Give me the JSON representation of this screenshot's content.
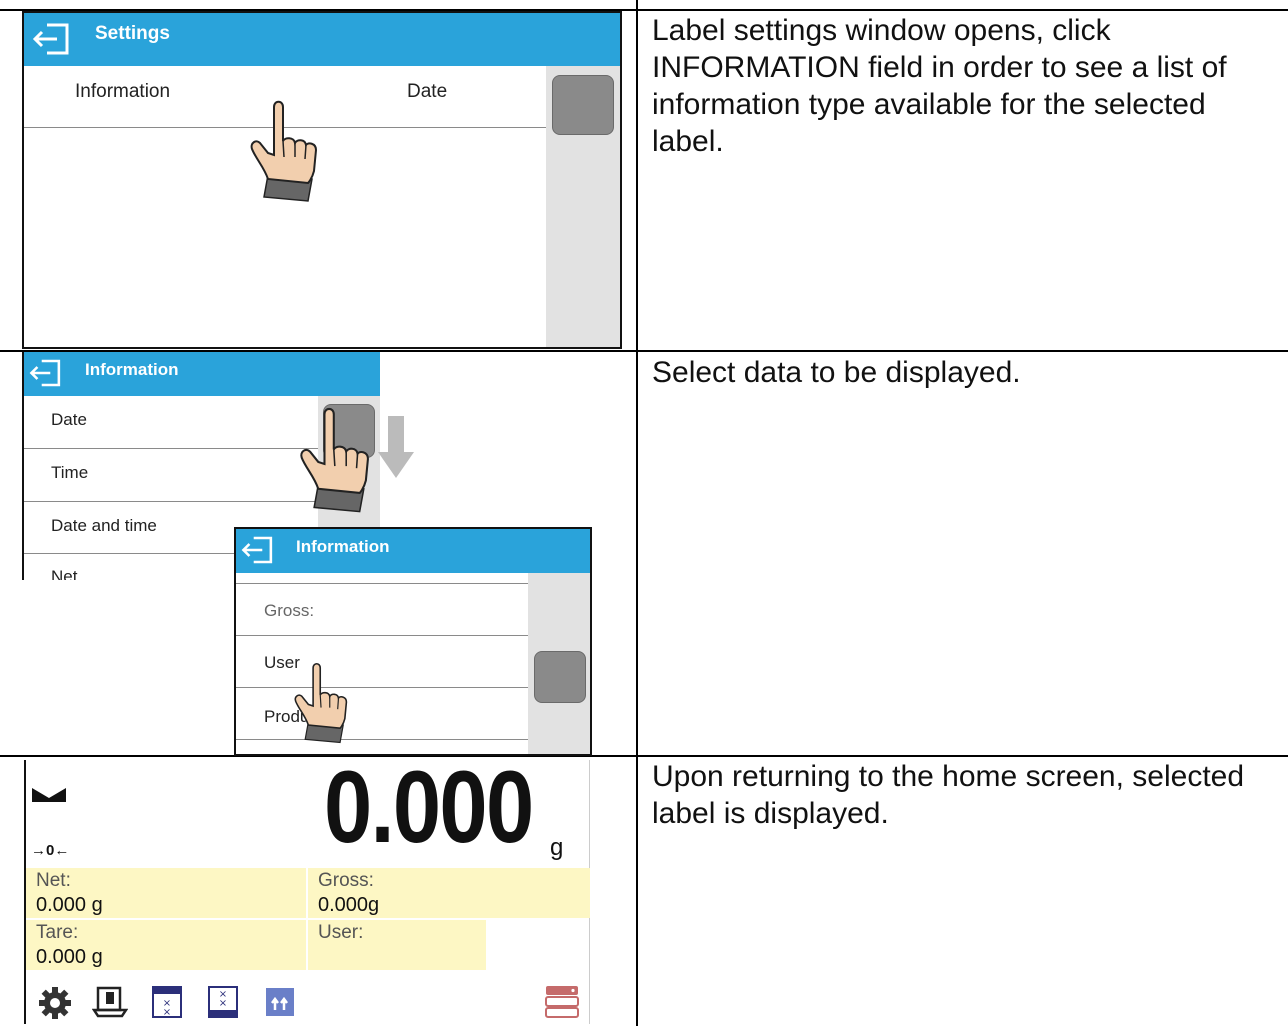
{
  "rows": [
    {
      "description": "Label settings window opens, click INFORMATION field in order to see a list of information type available for the selected label.",
      "screen": {
        "header_title": "Settings",
        "info_label": "Information",
        "info_value": "Date"
      }
    },
    {
      "description": "Select data to be displayed.",
      "screen_back": {
        "header_title": "Information",
        "items": [
          "Date",
          "Time",
          "Date and time",
          "Net"
        ]
      },
      "screen_front": {
        "header_title": "Information",
        "items": [
          "Gross:",
          "User",
          "Produ"
        ]
      }
    },
    {
      "description": "Upon returning to the home screen, selected label is displayed.",
      "home": {
        "weight": "0.000",
        "unit": "g",
        "zero_indicator": "→0←",
        "fields": [
          {
            "label": "Net:",
            "value": "0.000 g"
          },
          {
            "label": "Gross:",
            "value": "0.000g"
          },
          {
            "label": "Tare:",
            "value": "0.000 g"
          },
          {
            "label": "User:",
            "value": ""
          }
        ],
        "icons": [
          "settings-icon",
          "tare-icon",
          "label-icon",
          "database-icon",
          "chart-icon",
          "printer-menu-icon"
        ]
      }
    }
  ],
  "colors": {
    "header": "#2aa3da",
    "field": "#fdf7c4",
    "scroll_thumb": "#8a8a8a",
    "scroll_track": "#e2e2e2"
  }
}
